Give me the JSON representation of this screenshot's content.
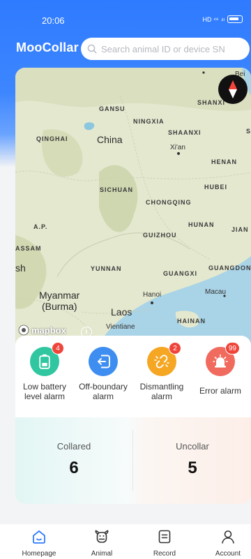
{
  "status_bar": {
    "time": "20:06",
    "network": "HD ⁴⁶",
    "signal": "ᵢₗₗ"
  },
  "header": {
    "app_name": "MooCollar",
    "search_placeholder": "Search animal ID or device SN"
  },
  "map": {
    "attribution": "mapbox",
    "info_symbol": "i",
    "labels": {
      "gansu": "GANSU",
      "ningxia": "NINGXIA",
      "qinghai": "QINGHAI",
      "china": "China",
      "shaanxi": "SHAANXI",
      "shanxi": "SHANXI",
      "xian": "Xi'an",
      "henan": "HENAN",
      "sichuan": "SICHUAN",
      "hubei": "HUBEI",
      "chongqing": "CHONGQING",
      "hunan": "HUNAN",
      "jian": "JIAN",
      "ap": "A.P.",
      "guizhou": "GUIZHOU",
      "assam": "ASSAM",
      "sh": "sh",
      "yunnan": "YUNNAN",
      "guangxi": "GUANGXI",
      "guangdong": "GUANGDON",
      "myanmar": "Myanmar",
      "burma": "(Burma)",
      "hanoi": "Hanoi",
      "macau": "Macau",
      "laos": "Laos",
      "vientiane": "Vientiane",
      "hainan": "HAINAN",
      "bei": "Bei",
      "s": "S"
    }
  },
  "alarms": [
    {
      "label": "Low battery level alarm",
      "count": "4",
      "color": "#2fc6a0",
      "icon": "battery-icon"
    },
    {
      "label": "Off-boundary alarm",
      "count": "",
      "color": "#3d8ef0",
      "icon": "boundary-exit-icon"
    },
    {
      "label": "Dismantling alarm",
      "count": "2",
      "color": "#f5a623",
      "icon": "broken-link-icon"
    },
    {
      "label": "Error alarm",
      "count": "99",
      "color": "#f06a5e",
      "icon": "siren-icon"
    }
  ],
  "stats": {
    "collared": {
      "label": "Collared",
      "value": "6"
    },
    "uncollar": {
      "label": "Uncollar",
      "value": "5"
    }
  },
  "nav": [
    {
      "label": "Homepage",
      "icon": "home-icon",
      "active": true
    },
    {
      "label": "Animal",
      "icon": "cow-icon",
      "active": false
    },
    {
      "label": "Record",
      "icon": "record-icon",
      "active": false
    },
    {
      "label": "Account",
      "icon": "user-icon",
      "active": false
    }
  ],
  "colors": {
    "primary": "#2f7bff",
    "badge": "#f0443a",
    "active_nav": "#2f7bff"
  }
}
